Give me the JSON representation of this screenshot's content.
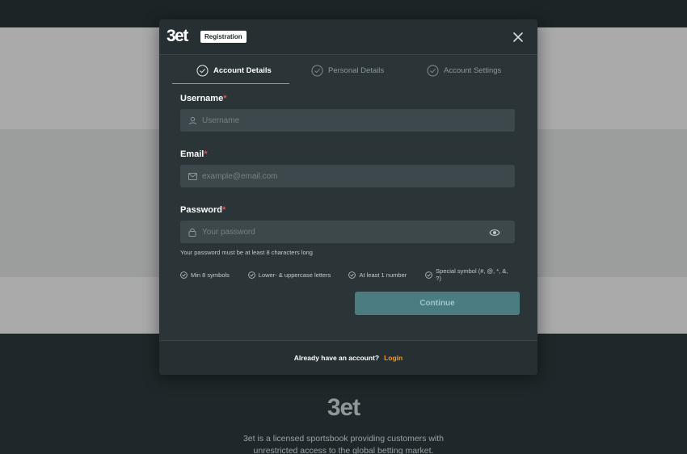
{
  "brand": {
    "logo_text": "3et",
    "badge": "Registration"
  },
  "steps": [
    {
      "label": "Account Details",
      "active": true
    },
    {
      "label": "Personal Details",
      "active": false
    },
    {
      "label": "Account Settings",
      "active": false
    }
  ],
  "form": {
    "username": {
      "label": "Username",
      "required_mark": "*",
      "placeholder": "Username",
      "value": ""
    },
    "email": {
      "label": "Email",
      "required_mark": "*",
      "placeholder": "example@email.com",
      "value": ""
    },
    "password": {
      "label": "Password",
      "required_mark": "*",
      "placeholder": "Your password",
      "value": "",
      "hint": "Your password must be at least 8 characters long",
      "rules": [
        "Min 8 symbols",
        "Lower- & uppercase letters",
        "At least 1 number",
        "Special symbol (#, @, *, &, ?)"
      ]
    },
    "continue_label": "Continue"
  },
  "footer": {
    "prompt": "Already have an account?",
    "login_label": "Login"
  },
  "background": {
    "footer_logo": "3et",
    "footer_text": "3et is a licensed sportsbook providing customers with unrestricted access to the global betting market."
  },
  "colors": {
    "accent": "#4a7c82",
    "login_link": "#f29a1f",
    "required": "#e34f4f"
  }
}
